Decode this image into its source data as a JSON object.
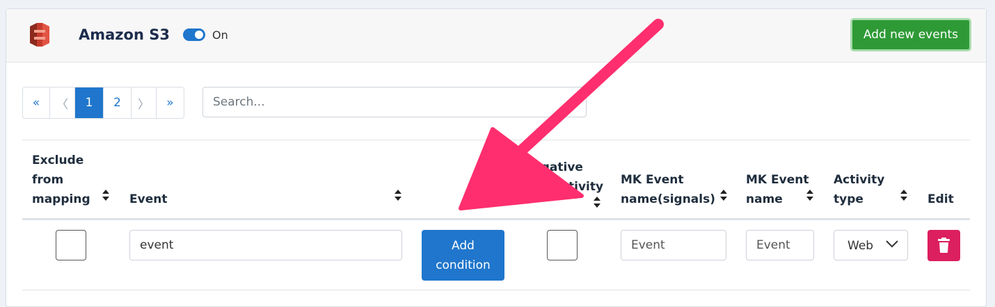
{
  "header": {
    "service_name": "Amazon S3",
    "logo_icon": "amazon-s3-logo",
    "toggle_label": "On",
    "toggle_on": true,
    "add_events_label": "Add new events"
  },
  "pagination": {
    "first": "«",
    "prev": "〈",
    "pages": [
      "1",
      "2"
    ],
    "active_page": "1",
    "next": "〉",
    "last": "»"
  },
  "search": {
    "placeholder": "Search..."
  },
  "table": {
    "columns": {
      "exclude": [
        "Exclude",
        "from",
        "mapping"
      ],
      "event": "Event",
      "negative": [
        "Negative",
        "User Activity"
      ],
      "mk_signals": [
        "MK Event",
        "name(signals)"
      ],
      "mk_name": [
        "MK Event",
        "name"
      ],
      "activity": [
        "Activity",
        "type"
      ],
      "edit": "Edit"
    },
    "row": {
      "exclude_checked": false,
      "event_value": "event",
      "add_condition_label": [
        "Add",
        "condition"
      ],
      "negative_checked": false,
      "mk_signals_placeholder": "Event",
      "mk_name_placeholder": "Event",
      "activity_selected": "Web",
      "delete_icon": "trash-icon"
    }
  },
  "colors": {
    "primary": "#1f76cc",
    "success": "#2e9a36",
    "danger": "#dc1f5e",
    "annotation_arrow": "#ff2e6e"
  }
}
